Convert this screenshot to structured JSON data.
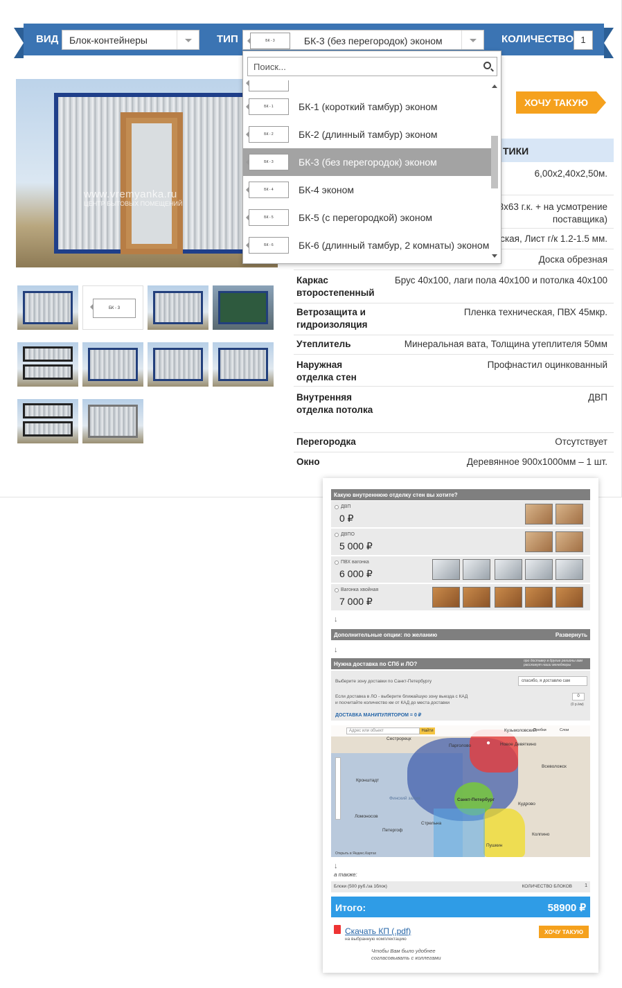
{
  "header": {
    "vid_label": "ВИД",
    "vid_value": "Блок-контейнеры",
    "tip_label": "ТИП",
    "tip_value": "БК-3 (без перегородок) эконом",
    "tip_plan": "БК - 3",
    "qty_label": "КОЛИЧЕСТВО",
    "qty_value": "1"
  },
  "dropdown": {
    "search_placeholder": "Поиск...",
    "items": [
      {
        "label": "БК-1 (короткий тамбур) эконом",
        "plan": "БК - 1"
      },
      {
        "label": "БК-2 (длинный тамбур) эконом",
        "plan": "БК - 2"
      },
      {
        "label": "БК-3 (без перегородок) эконом",
        "plan": "БК - 3",
        "selected": true
      },
      {
        "label": "БК-4 эконом",
        "plan": "БК - 4"
      },
      {
        "label": "БК-5 (с перегородкой) эконом",
        "plan": "БК - 5"
      },
      {
        "label": "БК-6 (длинный тамбур, 2 комнаты) эконом",
        "plan": "БК - 6"
      }
    ]
  },
  "gallery": {
    "watermark": "www.vremyanka.ru",
    "watermark_sub": "ЦЕНТР БЫТОВЫХ ПОМЕЩЕНИЙ",
    "thumb_plan": "БК - 3"
  },
  "want_button": "ХОЧУ ТАКУЮ",
  "specs_title": "ТИКИ",
  "specs": [
    {
      "key": "",
      "value": "6,00х2,40х2,50м."
    },
    {
      "key": "",
      "value": "мм. гнутый или 63х63 г.к. + на усмотрение поставщика)"
    },
    {
      "key": "",
      "value": "лоская, Лист г/к 1.2-1.5 мм."
    },
    {
      "key": "",
      "value": "Доска обрезная"
    },
    {
      "key": "Каркас второстепенный",
      "value": "Брус 40х100, лаги пола 40х100 и потолка 40х100"
    },
    {
      "key": "Ветрозащита и гидроизоляция",
      "value": "Пленка техническая, ПВХ 45мкр."
    },
    {
      "key": "Утеплитель",
      "value": "Минеральная вата, Толщина утеплителя 50мм"
    },
    {
      "key": "Наружная отделка стен",
      "value": "Профнастил оцинкованный"
    },
    {
      "key": "Внутренняя отделка потолка",
      "value": "ДВП"
    },
    {
      "key": "Перегородка",
      "value": "Отсутствует"
    },
    {
      "key": "Окно",
      "value": "Деревянное 900х1000мм – 1 шт."
    }
  ],
  "calc": {
    "finish_question": "Какую внутреннюю отделку стен вы хотите?",
    "finishes": [
      {
        "name": "ДВП",
        "price": "0 ₽"
      },
      {
        "name": "ДВПО",
        "price": "5 000 ₽"
      },
      {
        "name": "ПВХ вагонка",
        "price": "6 000 ₽"
      },
      {
        "name": "Вагонка хвойная",
        "price": "7 000 ₽"
      }
    ],
    "extra_options": "Дополнительные опции: по желанию",
    "expand": "Развернуть",
    "delivery_question": "Нужна доставка по СПб и ЛО?",
    "delivery_note": "про доставку в другие регионы вам расскажут наши менеджеры",
    "zone_label": "Выберите зону доставки по Санкт-Петербургу",
    "zone_value": "спасибо, я доставлю сам",
    "lo_text_1": "Если доставка в ЛО - выберите ближайшую зону выезда с КАД",
    "lo_text_2": "и посчитайте количество км от КАД до места доставки",
    "km_value": "0",
    "km_unit": "(0 р./км)",
    "manip": "ДОСТАВКА МАНИПУЛЯТОРОМ = 0 ₽",
    "map_search": "Адрес или объект",
    "map_go": "Найти",
    "map_traffic": "Пробки",
    "map_layers": "Слои",
    "map_city": "Санкт-Петербург",
    "map_places": [
      "Сестрорецк",
      "Кронштадт",
      "Ломоносов",
      "Петергоф",
      "Стрельна",
      "Пушкин",
      "Колпино",
      "Кудрово",
      "Новое Девяткино",
      "Кузьмоловский",
      "Всеволожск",
      "Парголово",
      "Финский залив"
    ],
    "map_footer": "Открыть в Яндекс.Картах",
    "also": "а также:",
    "blocks_label": "Блоки (500 руб./за 1блок)",
    "blocks_qty_label": "КОЛИЧЕСТВО БЛОКОВ",
    "blocks_qty": "1",
    "total_label": "Итого:",
    "total_value": "58900 ₽",
    "kp_link": "Скачать КП (.pdf)",
    "kp_sub": "на выбранную комплектацию",
    "want_small": "ХОЧУ ТАКУЮ",
    "handwritten": "Чтобы Вам было удобнее согласовывать с коллегами"
  }
}
